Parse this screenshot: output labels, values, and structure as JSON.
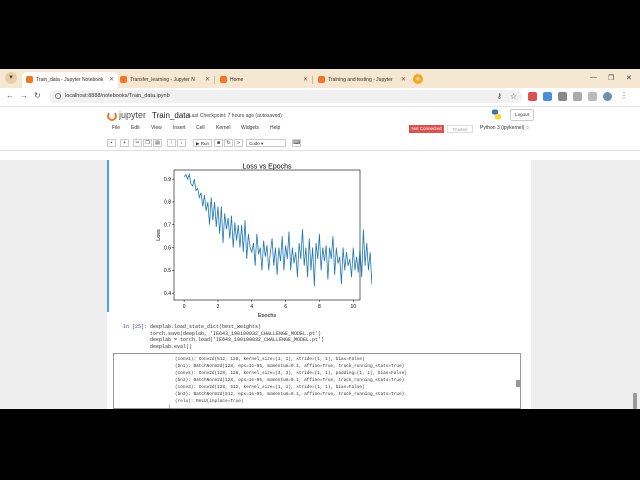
{
  "tabs": [
    {
      "label": "Train_data - Jupyter Notebook",
      "active": true
    },
    {
      "label": "Transfer_learning - Jupyter N",
      "active": false
    },
    {
      "label": "Home",
      "active": false
    },
    {
      "label": "Training and testing - Jupyter",
      "active": false
    }
  ],
  "address": {
    "url": "localhost:8888/notebooks/Train_data.ipynb"
  },
  "jupyter": {
    "logo_text": "jupyter",
    "notebook_name": "Train_data",
    "checkpoint": "Last Checkpoint: 7 hours ago  (autosaved)",
    "logout": "Logout",
    "menu": [
      "File",
      "Edit",
      "View",
      "Insert",
      "Cell",
      "Kernel",
      "Widgets",
      "Help"
    ],
    "status": "Not Connected",
    "trusted": "Trusted",
    "kernel": "Python 3 (ipykernel)",
    "run_label": "Run",
    "cell_type": "Code"
  },
  "chart_data": {
    "type": "line",
    "title": "Loss vs Epochs",
    "xlabel": "Epochs",
    "ylabel": "Loss",
    "xlim": [
      -0.6,
      10.4
    ],
    "ylim": [
      0.37,
      0.94
    ],
    "xticks": [
      0,
      2,
      4,
      6,
      8,
      10
    ],
    "yticks": [
      0.4,
      0.5,
      0.6,
      0.7,
      0.8,
      0.9
    ],
    "color": "#1f77b4",
    "series": [
      {
        "x_start": 0,
        "x_step": 0.1,
        "values": [
          0.91,
          0.92,
          0.9,
          0.92,
          0.88,
          0.87,
          0.9,
          0.85,
          0.86,
          0.82,
          0.84,
          0.78,
          0.83,
          0.76,
          0.8,
          0.7,
          0.82,
          0.72,
          0.8,
          0.69,
          0.78,
          0.66,
          0.78,
          0.62,
          0.75,
          0.68,
          0.73,
          0.64,
          0.74,
          0.6,
          0.71,
          0.63,
          0.7,
          0.6,
          0.7,
          0.58,
          0.72,
          0.55,
          0.66,
          0.6,
          0.58,
          0.62,
          0.52,
          0.66,
          0.57,
          0.6,
          0.5,
          0.63,
          0.56,
          0.61,
          0.5,
          0.58,
          0.64,
          0.52,
          0.6,
          0.48,
          0.6,
          0.54,
          0.65,
          0.5,
          0.61,
          0.55,
          0.67,
          0.5,
          0.6,
          0.53,
          0.58,
          0.47,
          0.62,
          0.55,
          0.68,
          0.52,
          0.6,
          0.47,
          0.64,
          0.5,
          0.6,
          0.43,
          0.62,
          0.55,
          0.66,
          0.5,
          0.6,
          0.54,
          0.61,
          0.46,
          0.6,
          0.55,
          0.65,
          0.48,
          0.6,
          0.53,
          0.56,
          0.44,
          0.6,
          0.5,
          0.58,
          0.52,
          0.55,
          0.47,
          0.6,
          0.5,
          0.56,
          0.49,
          0.6,
          0.47,
          0.68,
          0.52,
          0.62,
          0.5,
          0.58,
          0.44,
          0.6,
          0.53,
          0.57,
          0.5,
          0.62,
          0.45,
          0.55,
          0.52,
          0.65,
          0.46,
          0.6,
          0.52,
          0.58,
          0.47,
          0.62,
          0.55,
          0.67,
          0.49,
          0.6,
          0.54,
          0.46,
          0.58,
          0.51,
          0.65,
          0.48,
          0.6,
          0.53,
          0.56,
          0.5,
          0.62,
          0.55,
          0.68,
          0.52,
          0.58,
          0.48,
          0.6,
          0.53,
          0.57,
          0.5,
          0.6,
          0.53,
          0.58,
          0.48,
          0.55,
          0.52,
          0.58,
          0.5,
          0.6,
          0.45,
          0.58,
          0.52,
          0.6,
          0.47,
          0.55,
          0.5,
          0.6,
          0.52,
          0.56,
          0.48,
          0.58,
          0.53,
          0.62,
          0.47,
          0.57,
          0.5,
          0.55,
          0.46,
          0.58,
          0.5,
          0.6,
          0.52,
          0.55,
          0.47,
          0.6,
          0.5,
          0.56,
          0.52,
          0.61,
          0.48,
          0.59,
          0.5,
          0.55,
          0.6,
          0.47,
          0.58,
          0.76
        ]
      }
    ]
  },
  "cell": {
    "prompt": "In [25]:",
    "code": [
      "deeplab.load_state_dict(best_weights)",
      "torch.save(deeplab, 'IE643_190100032_CHALLENGE_MODEL.pt')",
      "deeplab = torch.load('IE643_190100032_CHALLENGE_MODEL.pt')",
      "deeplab.eval()"
    ]
  },
  "output": [
    "(conv1): Conv2d(512, 128, kernel_size=(1, 1), stride=(1, 1), bias=False)",
    "(bn1): BatchNorm2d(128, eps=1e-05, momentum=0.1, affine=True, track_running_stats=True)",
    "(conv2): Conv2d(128, 128, kernel_size=(3, 3), stride=(1, 1), padding=(1, 1), bias=False)",
    "(bn2): BatchNorm2d(128, eps=1e-05, momentum=0.1, affine=True, track_running_stats=True)",
    "(conv3): Conv2d(128, 512, kernel_size=(1, 1), stride=(1, 1), bias=False)",
    "(bn3): BatchNorm2d(512, eps=1e-05, momentum=0.1, affine=True, track_running_stats=True)",
    "(relu): ReLU(inplace=True)",
    ")"
  ]
}
